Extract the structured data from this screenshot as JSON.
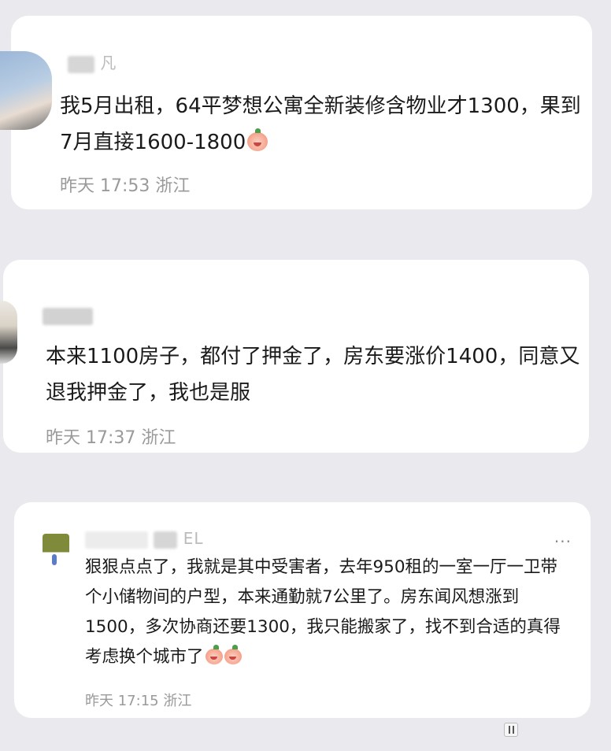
{
  "comments": [
    {
      "username": "凡",
      "text": "我5月出租，64平梦想公寓全新装修含物业才1300，果到7月直接1600-1800",
      "emoji": "crying-peach-emoji",
      "time": "昨天 17:53",
      "location": "浙江"
    },
    {
      "username": "",
      "text": "本来1100房子，都付了押金了，房东要涨价1400，同意又退我押金了，我也是服",
      "time": "昨天 17:37",
      "location": "浙江"
    },
    {
      "username": "EL",
      "text": "狠狠点点了，我就是其中受害者，去年950租的一室一厅一卫带个小储物间的户型，本来通勤就7公里了。房东闻风想涨到1500，多次协商还要1300，我只能搬家了，找不到合适的真得考虑换个城市了",
      "emoji": "peach-face-emoji",
      "time": "昨天 17:15",
      "location": "浙江",
      "more_label": "···"
    }
  ],
  "colors": {
    "background": "#e9e9ee",
    "card": "#ffffff",
    "meta": "#9a9a9a"
  }
}
